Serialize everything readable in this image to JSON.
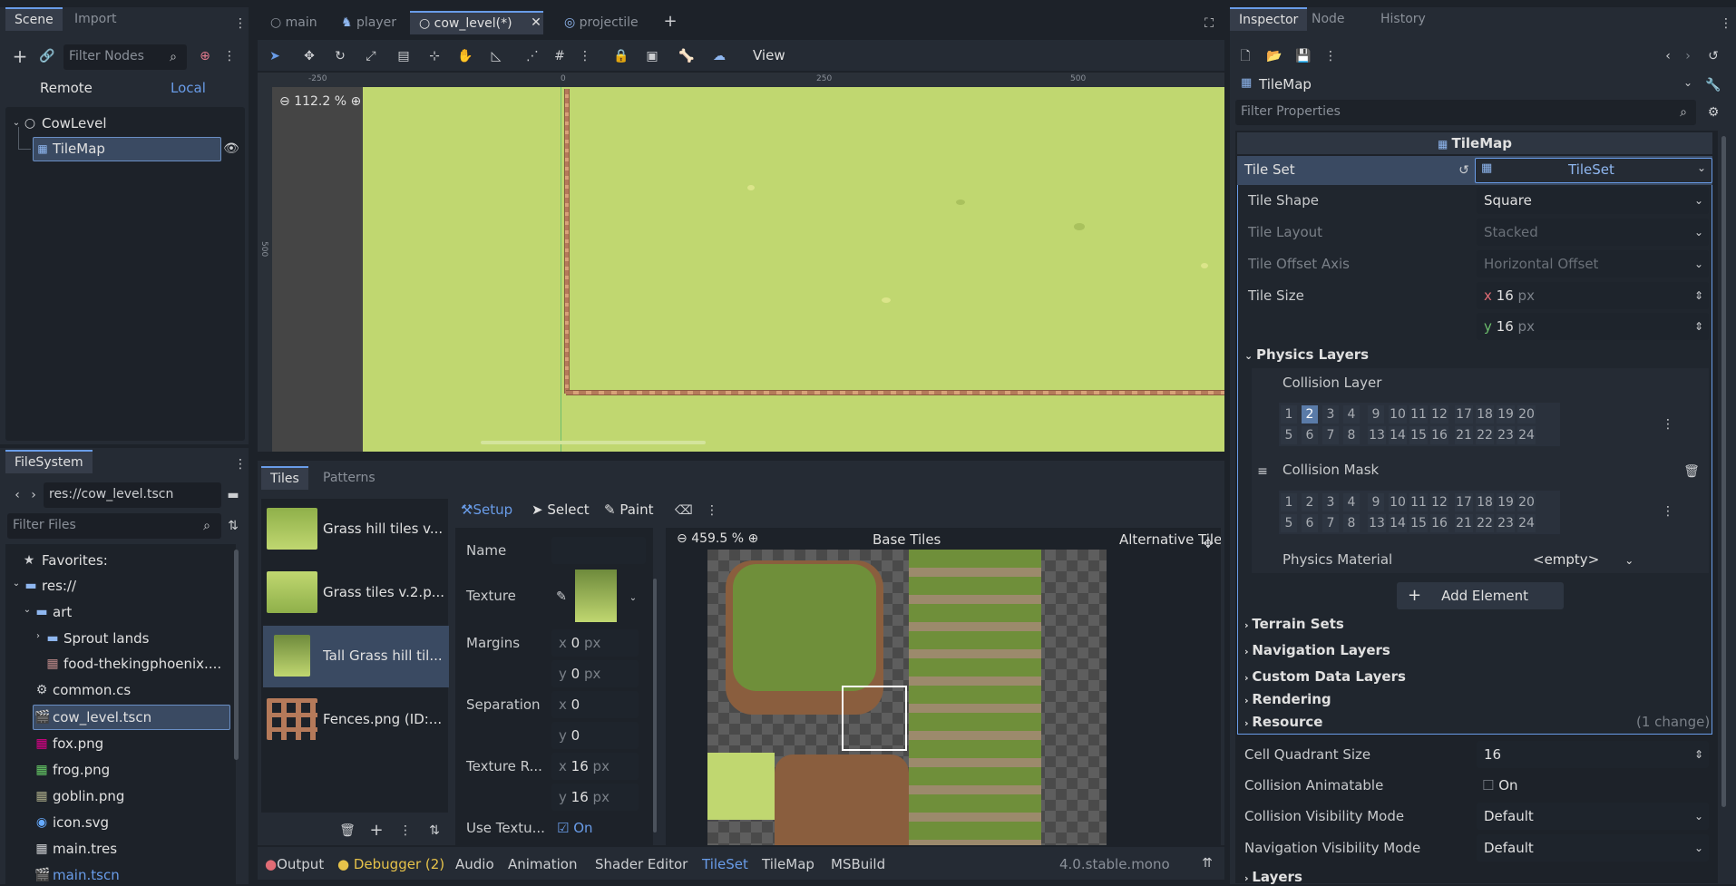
{
  "scene_dock": {
    "tabs": [
      "Scene",
      "Import"
    ],
    "filter_placeholder": "Filter Nodes",
    "remote_label": "Remote",
    "local_label": "Local",
    "nodes": [
      {
        "name": "CowLevel",
        "icon": "node-circle-icon"
      },
      {
        "name": "TileMap",
        "icon": "tilemap-icon"
      }
    ]
  },
  "filesystem_dock": {
    "tab": "FileSystem",
    "path": "res://cow_level.tscn",
    "filter_placeholder": "Filter Files",
    "items": [
      {
        "label": "Favorites:",
        "icon": "star-icon"
      },
      {
        "label": "res://",
        "icon": "folder-icon"
      },
      {
        "label": "art",
        "icon": "folder-icon"
      },
      {
        "label": "Sprout lands",
        "icon": "folder-icon"
      },
      {
        "label": "food-thekingphoenix....",
        "icon": "image-icon"
      },
      {
        "label": "common.cs",
        "icon": "gear-icon"
      },
      {
        "label": "cow_level.tscn",
        "icon": "scene-icon"
      },
      {
        "label": "fox.png",
        "icon": "image-icon"
      },
      {
        "label": "frog.png",
        "icon": "image-icon"
      },
      {
        "label": "goblin.png",
        "icon": "image-icon"
      },
      {
        "label": "icon.svg",
        "icon": "image-icon"
      },
      {
        "label": "main.tres",
        "icon": "resource-icon"
      },
      {
        "label": "main.tscn",
        "icon": "scene-icon"
      }
    ]
  },
  "scene_tabs": [
    {
      "label": "main",
      "icon": "node-circle-icon"
    },
    {
      "label": "player",
      "icon": "character-icon"
    },
    {
      "label": "cow_level(*)",
      "icon": "node-circle-icon"
    },
    {
      "label": "projectile",
      "icon": "globe-icon"
    }
  ],
  "viewport": {
    "zoom": "112.2 %",
    "view_label": "View",
    "ruler_marks": [
      "-250",
      "0",
      "250",
      "500"
    ],
    "ruler_v_mark": "500"
  },
  "tileset_panel": {
    "tabs": [
      "Tiles",
      "Patterns"
    ],
    "sources": [
      {
        "label": "Grass hill tiles v..."
      },
      {
        "label": "Grass tiles v.2.p..."
      },
      {
        "label": "Tall Grass hill til..."
      },
      {
        "label": "Fences.png (ID:..."
      }
    ],
    "modes": [
      "Setup",
      "Select",
      "Paint"
    ],
    "props": {
      "name": "Name",
      "texture": "Texture",
      "margins": "Margins",
      "margins_x": "0",
      "margins_y": "0",
      "separation": "Separation",
      "separation_x": "0",
      "separation_y": "0",
      "texture_region": "Texture R...",
      "region_x": "16",
      "region_y": "16",
      "use_texture": "Use Textu...",
      "on_label": "On",
      "px": "px",
      "x": "x",
      "y": "y"
    },
    "atlas_zoom": "459.5 %",
    "base_tiles": "Base Tiles",
    "alternative_tiles": "Alternative Tile"
  },
  "bottom_bar": {
    "tabs": [
      "Output",
      "Debugger (2)",
      "Audio",
      "Animation",
      "Shader Editor",
      "TileSet",
      "TileMap",
      "MSBuild"
    ],
    "version": "4.0.stable.mono"
  },
  "inspector": {
    "tabs": [
      "Inspector",
      "Node",
      "History"
    ],
    "object": "TileMap",
    "filter_placeholder": "Filter Properties",
    "header": "TileMap",
    "tile_set_label": "Tile Set",
    "tile_set_value": "TileSet",
    "rows": {
      "tile_shape": {
        "label": "Tile Shape",
        "value": "Square"
      },
      "tile_layout": {
        "label": "Tile Layout",
        "value": "Stacked"
      },
      "tile_offset_axis": {
        "label": "Tile Offset Axis",
        "value": "Horizontal Offset"
      },
      "tile_size": {
        "label": "Tile Size",
        "x": "16",
        "y": "16",
        "unit": "px"
      }
    },
    "physics_layers": "Physics Layers",
    "collision_layer": "Collision Layer",
    "collision_mask": "Collision Mask",
    "layer_numbers_top": [
      "1",
      "2",
      "3",
      "4",
      "9",
      "10",
      "11",
      "12",
      "17",
      "18",
      "19",
      "20"
    ],
    "layer_numbers_bottom": [
      "5",
      "6",
      "7",
      "8",
      "13",
      "14",
      "15",
      "16",
      "21",
      "22",
      "23",
      "24"
    ],
    "collision_layer_selected": "2",
    "physics_material": {
      "label": "Physics Material",
      "value": "<empty>"
    },
    "add_element": "Add Element",
    "sections": [
      "Terrain Sets",
      "Navigation Layers",
      "Custom Data Layers",
      "Rendering",
      "Resource"
    ],
    "resource_change": "(1 change)",
    "cell_quadrant_size": {
      "label": "Cell Quadrant Size",
      "value": "16"
    },
    "collision_animatable": {
      "label": "Collision Animatable",
      "value": "On"
    },
    "collision_visibility": {
      "label": "Collision Visibility Mode",
      "value": "Default"
    },
    "navigation_visibility": {
      "label": "Navigation Visibility Mode",
      "value": "Default"
    },
    "layers": "Layers"
  },
  "colors": {
    "accent": "#699ce8",
    "grass": "#c0d770",
    "fence": "#b57a5a",
    "selected_bg": "#3a4a62"
  }
}
